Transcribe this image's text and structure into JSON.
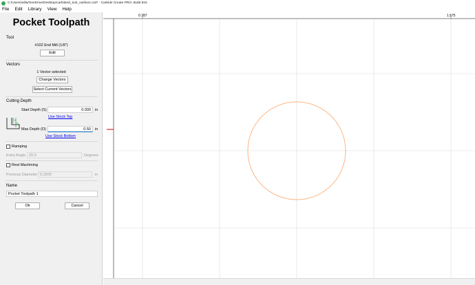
{
  "window": {
    "title": "C:/Users/willa/OneDrive/Desktop/carbide/d_tool_outlines.c2d* - Carbide Create PRO: Build 816"
  },
  "menu": {
    "items": [
      "File",
      "Edit",
      "Library",
      "View",
      "Help"
    ]
  },
  "panel": {
    "title": "Pocket Toolpath",
    "tool": {
      "label": "Tool",
      "name": "#102 End Mill (1/8\")",
      "edit_label": "Edit"
    },
    "vectors": {
      "label": "Vectors",
      "status": "1 Vector selected",
      "change_label": "Change Vectors",
      "select_current_label": "Select Current Vectors"
    },
    "cutting_depth": {
      "label": "Cutting Depth",
      "start_label": "Start Depth (S)",
      "start_value": "0.000",
      "start_unit": "in",
      "use_stock_top": "Use Stock Top",
      "max_label": "Max Depth (D)",
      "max_value": "0.50",
      "max_unit": "in",
      "use_stock_bottom": "Use Stock Bottom",
      "diagram_s": "S",
      "diagram_d": "D"
    },
    "ramping": {
      "label": "Ramping",
      "checked": false,
      "entry_angle_label": "Entry Angle",
      "entry_angle_value": "20.0",
      "entry_angle_unit": "Degrees"
    },
    "rest_machining": {
      "label": "Rest Machining",
      "checked": false,
      "prev_diameter_label": "Previous Diameter",
      "prev_diameter_value": "0.2500",
      "prev_diameter_unit": "in"
    },
    "name": {
      "label": "Name",
      "value": "Pocket Toolpath 1"
    },
    "ok_label": "Ok",
    "cancel_label": "Cancel"
  },
  "canvas": {
    "ruler_labels": [
      "0.787",
      "1.575"
    ],
    "circle_color": "#ff7f27",
    "grid_color": "#d9d9d9",
    "marker_color": "#cc0000"
  }
}
